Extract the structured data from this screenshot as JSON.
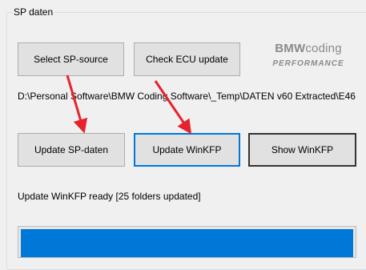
{
  "group": {
    "title": "SP daten"
  },
  "buttons": {
    "select_sp_source": "Select SP-source",
    "check_ecu_update": "Check ECU update",
    "update_sp_daten": "Update SP-daten",
    "update_winkfp": "Update WinKFP",
    "show_winkfp": "Show WinKFP"
  },
  "logo": {
    "main_bold": "BMW",
    "main_rest": "coding",
    "sub": "PERFORMANCE"
  },
  "path": "D:\\Personal Software\\BMW Coding Software\\_Temp\\DATEN v60 Extracted\\E46",
  "status": "Update WinKFP ready [25 folders updated]",
  "progress": {
    "fraction": 1.0
  },
  "colors": {
    "accent": "#0078d7",
    "annotation": "#e8222b"
  }
}
